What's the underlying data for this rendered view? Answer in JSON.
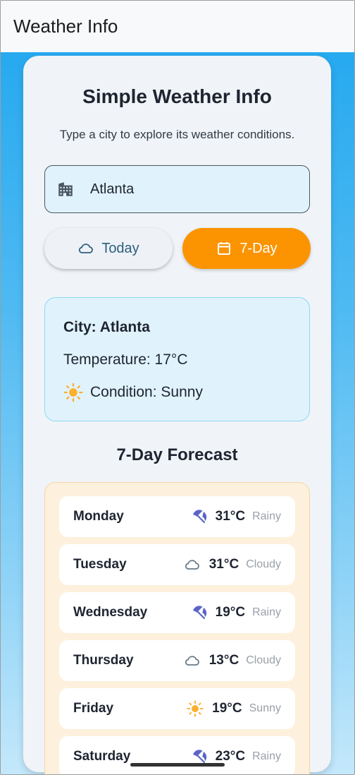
{
  "appbar": {
    "title": "Weather Info"
  },
  "card": {
    "title": "Simple Weather Info",
    "subtitle": "Type a city to explore its weather conditions."
  },
  "search": {
    "value": "Atlanta",
    "icon": "building-icon"
  },
  "toggle": {
    "today_label": "Today",
    "week_label": "7-Day",
    "selected": "7-Day",
    "accent": "#fb9400"
  },
  "current": {
    "city": "City: Atlanta",
    "temperature": "Temperature: 17°C",
    "condition": "Condition: Sunny"
  },
  "forecast": {
    "title": "7-Day Forecast",
    "days": [
      {
        "day": "Monday",
        "temp": "31°C",
        "condition": "Rainy",
        "icon": "umbrella-icon"
      },
      {
        "day": "Tuesday",
        "temp": "31°C",
        "condition": "Cloudy",
        "icon": "cloud-icon"
      },
      {
        "day": "Wednesday",
        "temp": "19°C",
        "condition": "Rainy",
        "icon": "umbrella-icon"
      },
      {
        "day": "Thursday",
        "temp": "13°C",
        "condition": "Cloudy",
        "icon": "cloud-icon"
      },
      {
        "day": "Friday",
        "temp": "19°C",
        "condition": "Sunny",
        "icon": "sun-icon"
      },
      {
        "day": "Saturday",
        "temp": "23°C",
        "condition": "Rainy",
        "icon": "umbrella-icon"
      }
    ]
  }
}
